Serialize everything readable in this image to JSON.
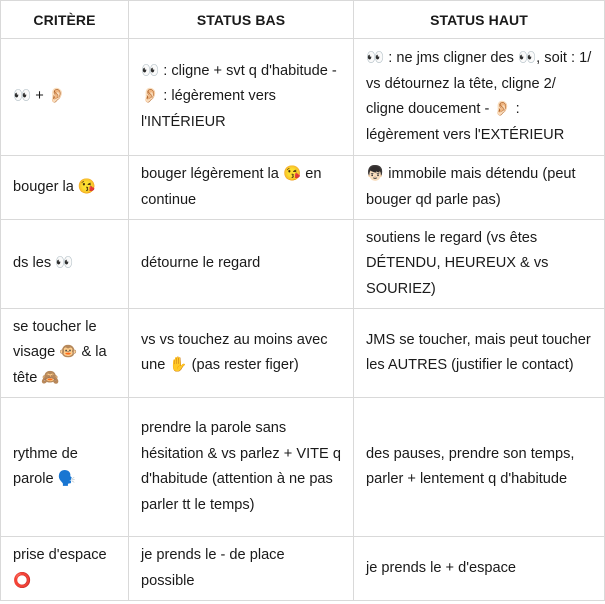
{
  "headers": [
    "CRITÈRE",
    "STATUS BAS",
    "STATUS HAUT"
  ],
  "rows": [
    {
      "critere": "👀 + 👂🏻",
      "bas": "👀 : cligne + svt q d'habitude - 👂🏻 : légèrement vers l'INTÉRIEUR",
      "haut": "👀 : ne jms cligner des 👀, soit : 1/ vs détournez la tête, cligne 2/ cligne doucement - 👂🏻 : légèrement vers l'EXTÉRIEUR"
    },
    {
      "critere": "bouger la 😘",
      "bas": "bouger légèrement la 😘 en continue",
      "haut": "👦🏻 immobile mais détendu (peut bouger qd parle pas)"
    },
    {
      "critere": "ds les 👀",
      "bas": "détourne le regard",
      "haut": "soutiens le regard (vs êtes DÉTENDU, HEUREUX & vs SOURIEZ)"
    },
    {
      "critere": "se toucher le visage 🐵 & la tête 🙈",
      "bas": "vs vs touchez au moins avec une ✋ (pas rester figer)",
      "haut": "JMS se toucher, mais peut toucher les AUTRES (justifier le contact)"
    },
    {
      "critere": "rythme de parole 🗣️",
      "bas": "prendre la parole sans hésitation & vs parlez + VITE q d'habitude (attention à ne pas parler tt le temps)",
      "haut": "des pauses, prendre son temps, parler + lentement q d'habitude"
    },
    {
      "critere": "prise d'espace ⭕",
      "bas": "je prends le - de place possible",
      "haut": "je prends le + d'espace"
    }
  ]
}
